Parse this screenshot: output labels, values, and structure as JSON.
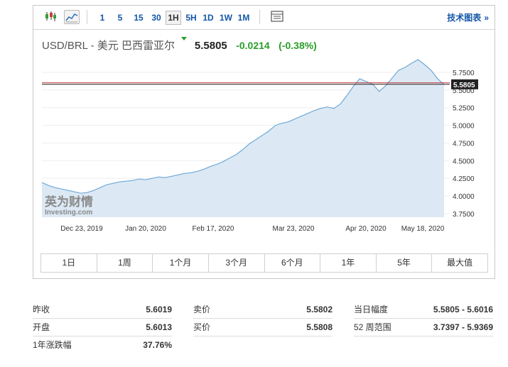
{
  "toolbar": {
    "candle_icon": "candlestick-icon",
    "line_icon": "line-chart-icon",
    "timeframes": [
      "1",
      "5",
      "15",
      "30",
      "1H",
      "5H",
      "1D",
      "1W",
      "1M"
    ],
    "active_timeframe": "1H",
    "table_icon": "table-icon",
    "advanced_chart_label": "技术图表",
    "advanced_chart_arrow": "»"
  },
  "quote": {
    "name": "USD/BRL - 美元 巴西雷亚尔",
    "price": "5.5805",
    "change": "-0.0214",
    "change_pct": "(-0.38%)",
    "direction": "down",
    "change_color": "#2a9d2a"
  },
  "chart_data": {
    "type": "area",
    "x_tick_labels": [
      "Dec 23, 2019",
      "Jan 20, 2020",
      "Feb 17, 2020",
      "Mar 23, 2020",
      "Apr 20, 2020",
      "May 18, 2020"
    ],
    "y_tick_labels": [
      "5.7500",
      "5.5000",
      "5.2500",
      "5.0000",
      "4.7500",
      "4.5000",
      "4.2500",
      "4.0000",
      "3.7500"
    ],
    "ylim": [
      3.7,
      5.95
    ],
    "current_price_label": "5.5805",
    "current_price": 5.5805,
    "reference_line": 5.6019,
    "watermark": "英为财情 Investing.com",
    "line_color": "#6fa8d6",
    "fill_color": "#dce9f4",
    "values": [
      4.19,
      4.15,
      4.12,
      4.1,
      4.08,
      4.06,
      4.04,
      4.05,
      4.08,
      4.12,
      4.16,
      4.18,
      4.2,
      4.21,
      4.22,
      4.24,
      4.23,
      4.25,
      4.27,
      4.26,
      4.28,
      4.3,
      4.32,
      4.33,
      4.35,
      4.38,
      4.42,
      4.45,
      4.49,
      4.54,
      4.59,
      4.66,
      4.74,
      4.8,
      4.86,
      4.92,
      5.0,
      5.03,
      5.05,
      5.09,
      5.13,
      5.17,
      5.21,
      5.24,
      5.26,
      5.24,
      5.3,
      5.42,
      5.55,
      5.66,
      5.62,
      5.58,
      5.48,
      5.56,
      5.67,
      5.78,
      5.82,
      5.88,
      5.93,
      5.86,
      5.78,
      5.66,
      5.58
    ]
  },
  "ranges": [
    "1日",
    "1周",
    "1个月",
    "3个月",
    "6个月",
    "1年",
    "5年",
    "最大值"
  ],
  "stats": {
    "prev_close": {
      "label": "昨收",
      "value": "5.6019"
    },
    "open": {
      "label": "开盘",
      "value": "5.6013"
    },
    "one_year_change": {
      "label": "1年涨跌幅",
      "value": "37.76%"
    },
    "bid": {
      "label": "卖价",
      "value": "5.5802"
    },
    "ask": {
      "label": "买价",
      "value": "5.5808"
    },
    "day_range": {
      "label": "当日幅度",
      "value": "5.5805 - 5.6016"
    },
    "week52_range": {
      "label": "52 周范围",
      "value": "3.7397 - 5.9369"
    }
  }
}
